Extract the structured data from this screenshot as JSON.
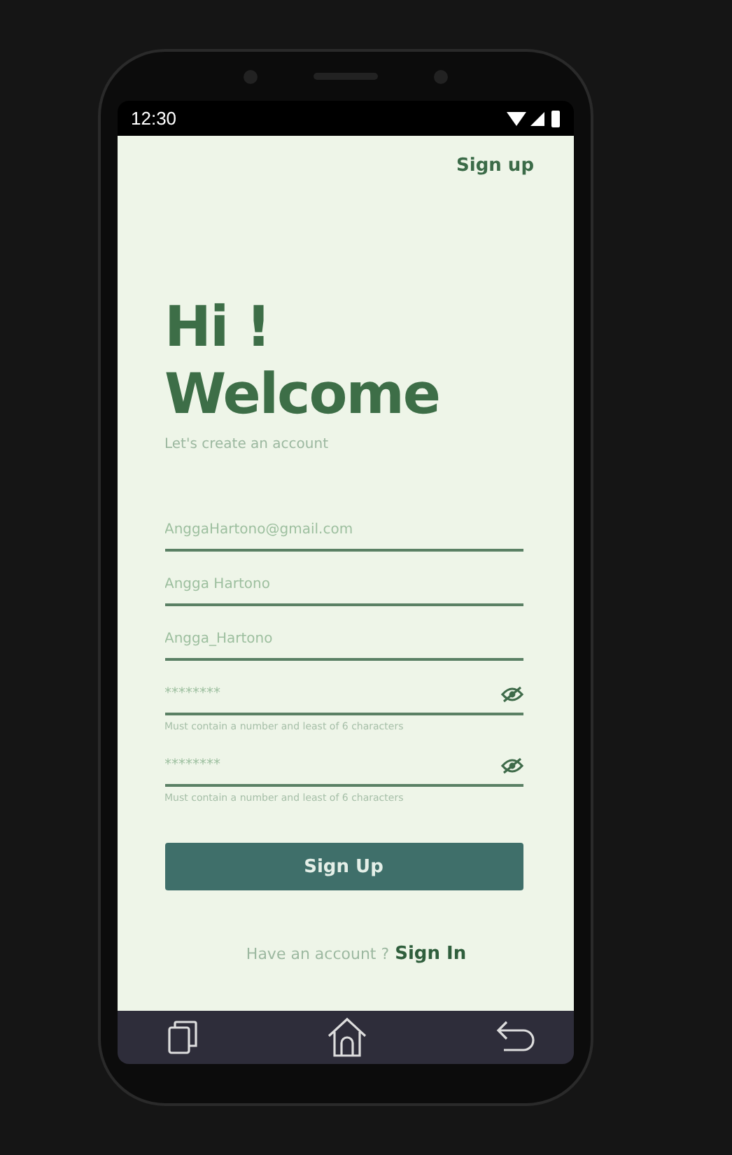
{
  "status_bar": {
    "time": "12:30"
  },
  "header": {
    "link": "Sign up"
  },
  "heading": {
    "line_1": "Hi !",
    "line_2": "Welcome",
    "subtitle": "Let's create an account"
  },
  "fields": [
    {
      "kind": "text",
      "placeholder": "AnggaHartono@gmail.com"
    },
    {
      "kind": "text",
      "placeholder": "Angga Hartono"
    },
    {
      "kind": "text",
      "placeholder": "Angga_Hartono"
    },
    {
      "kind": "password",
      "placeholder": "********",
      "hint": "Must contain a number and least of 6 characters"
    },
    {
      "kind": "password",
      "placeholder": "********",
      "hint": "Must contain a number and least of 6 characters"
    }
  ],
  "submit_button": "Sign Up",
  "footer": {
    "prompt": "Have an account ?",
    "link": "Sign In"
  }
}
